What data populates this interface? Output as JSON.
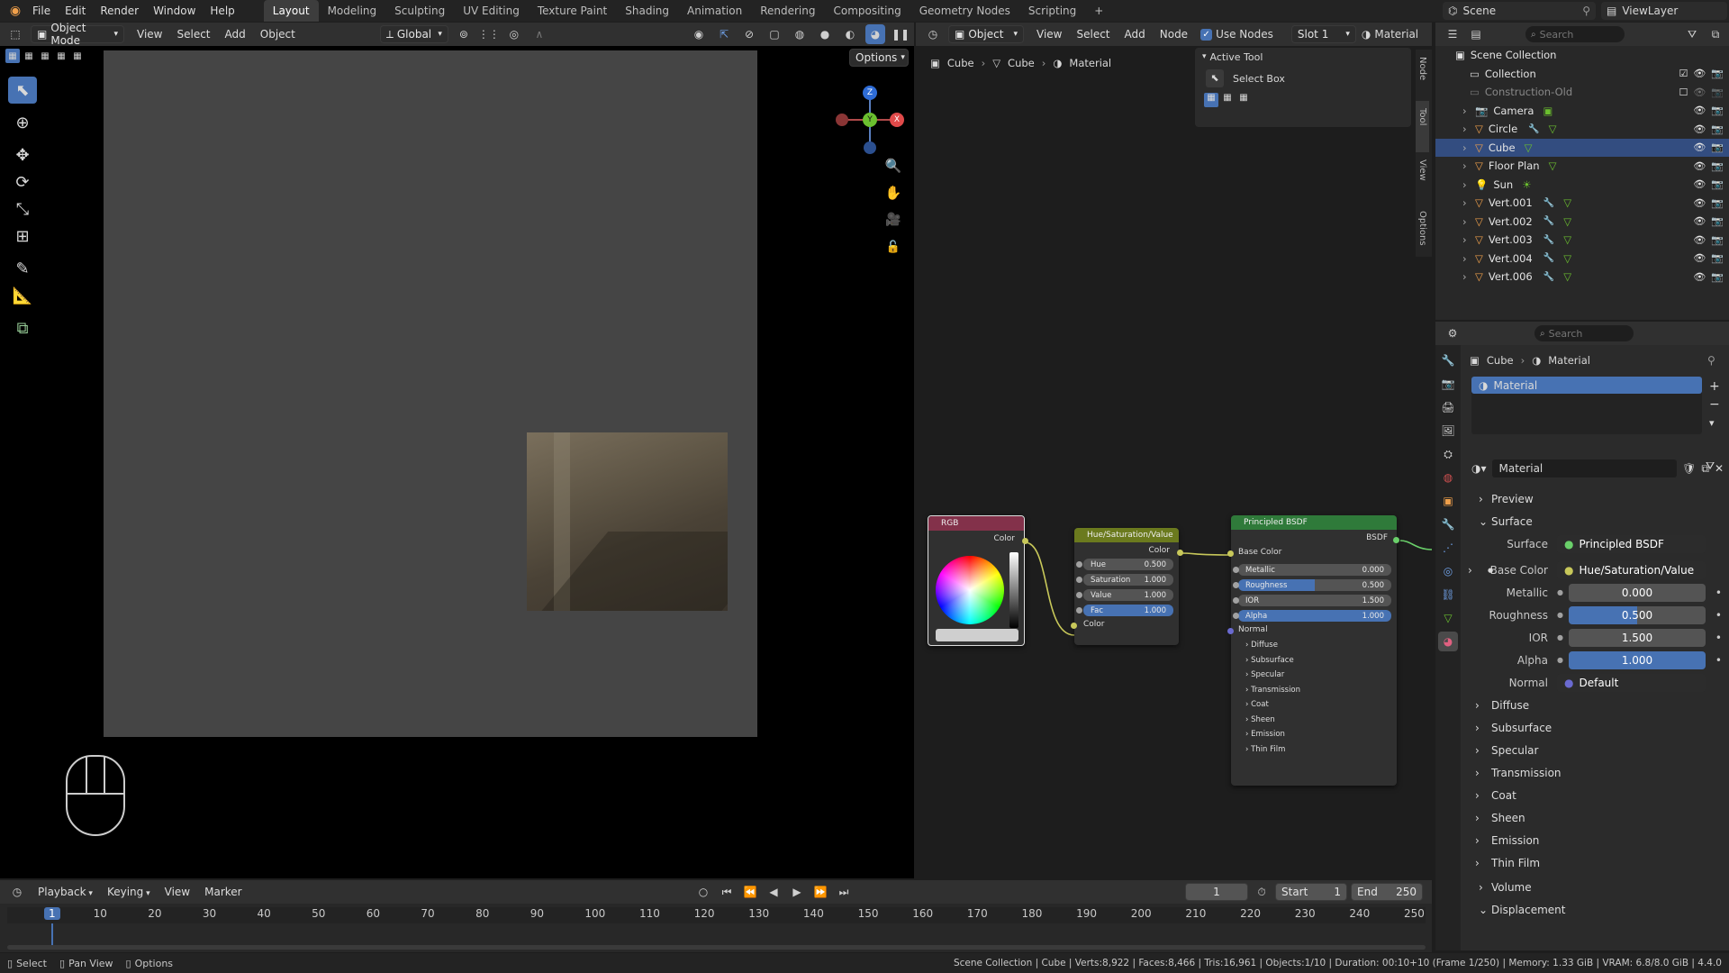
{
  "topbar": {
    "menu": [
      "File",
      "Edit",
      "Render",
      "Window",
      "Help"
    ],
    "workspaces": [
      "Layout",
      "Modeling",
      "Sculpting",
      "UV Editing",
      "Texture Paint",
      "Shading",
      "Animation",
      "Rendering",
      "Compositing",
      "Geometry Nodes",
      "Scripting"
    ],
    "active_workspace": "Layout",
    "add_tab": "+",
    "scene": "Scene",
    "view_layer": "ViewLayer"
  },
  "viewport": {
    "mode": "Object Mode",
    "menu": [
      "View",
      "Select",
      "Add",
      "Object"
    ],
    "transform_orientation": "Global",
    "options_label": "Options",
    "gizmo": {
      "z": "Z",
      "y": "Y",
      "x": "X"
    }
  },
  "node_editor": {
    "object_type": "Object",
    "menu": [
      "View",
      "Select",
      "Add",
      "Node"
    ],
    "use_nodes_label": "Use Nodes",
    "slot": "Slot 1",
    "material": "Material",
    "breadcrumb": [
      "Cube",
      "Cube",
      "Material"
    ],
    "side_tabs": [
      "Node",
      "Tool",
      "View",
      "Options"
    ],
    "active_tool": {
      "title": "Active Tool",
      "tool": "Select Box"
    },
    "rgb_node": {
      "title": "RGB",
      "output": "Color"
    },
    "hsv_node": {
      "title": "Hue/Saturation/Value",
      "output": "Color",
      "fields": [
        {
          "label": "Hue",
          "value": "0.500"
        },
        {
          "label": "Saturation",
          "value": "1.000"
        },
        {
          "label": "Value",
          "value": "1.000"
        },
        {
          "label": "Fac",
          "value": "1.000"
        }
      ],
      "input": "Color"
    },
    "bsdf_node": {
      "title": "Principled BSDF",
      "output": "BSDF",
      "base_color": "Base Color",
      "fields": [
        {
          "label": "Metallic",
          "value": "0.000",
          "fill": 0
        },
        {
          "label": "Roughness",
          "value": "0.500",
          "fill": 0.5
        },
        {
          "label": "IOR",
          "value": "1.500",
          "fill": 0
        },
        {
          "label": "Alpha",
          "value": "1.000",
          "fill": 1
        }
      ],
      "normal": "Normal",
      "subpanels": [
        "Diffuse",
        "Subsurface",
        "Specular",
        "Transmission",
        "Coat",
        "Sheen",
        "Emission",
        "Thin Film"
      ]
    }
  },
  "outliner": {
    "search_placeholder": "Search",
    "root": "Scene Collection",
    "items": [
      {
        "name": "Collection",
        "type": "collection"
      },
      {
        "name": "Construction-Old",
        "type": "collection-off"
      },
      {
        "name": "Camera",
        "type": "camera"
      },
      {
        "name": "Circle",
        "type": "mesh"
      },
      {
        "name": "Cube",
        "type": "mesh",
        "selected": true
      },
      {
        "name": "Floor Plan",
        "type": "mesh"
      },
      {
        "name": "Sun",
        "type": "light"
      },
      {
        "name": "Vert.001",
        "type": "mesh"
      },
      {
        "name": "Vert.002",
        "type": "mesh"
      },
      {
        "name": "Vert.003",
        "type": "mesh"
      },
      {
        "name": "Vert.004",
        "type": "mesh"
      },
      {
        "name": "Vert.006",
        "type": "mesh"
      }
    ]
  },
  "properties": {
    "search_placeholder": "Search",
    "breadcrumb": [
      "Cube",
      "Material"
    ],
    "slot_item": "Material",
    "material_name": "Material",
    "preview": "Preview",
    "surface_section": "Surface",
    "surface": {
      "label": "Surface",
      "value": "Principled BSDF"
    },
    "base_color": {
      "label": "Base Color",
      "value": "Hue/Saturation/Value"
    },
    "fields": [
      {
        "label": "Metallic",
        "value": "0.000",
        "fill": 0
      },
      {
        "label": "Roughness",
        "value": "0.500",
        "fill": 0.5
      },
      {
        "label": "IOR",
        "value": "1.500",
        "fill": 0
      },
      {
        "label": "Alpha",
        "value": "1.000",
        "fill": 1
      }
    ],
    "normal": {
      "label": "Normal",
      "value": "Default"
    },
    "subpanels": [
      "Diffuse",
      "Subsurface",
      "Specular",
      "Transmission",
      "Coat",
      "Sheen",
      "Emission",
      "Thin Film"
    ],
    "volume": "Volume",
    "displacement": "Displacement"
  },
  "timeline": {
    "menu": [
      "Playback",
      "Keying",
      "View",
      "Marker"
    ],
    "current_frame": "1",
    "start_label": "Start",
    "start": "1",
    "end_label": "End",
    "end": "250",
    "ticks": [
      "1",
      "10",
      "20",
      "30",
      "40",
      "50",
      "60",
      "70",
      "80",
      "90",
      "100",
      "110",
      "120",
      "130",
      "140",
      "150",
      "160",
      "170",
      "180",
      "190",
      "200",
      "210",
      "220",
      "230",
      "240",
      "250"
    ]
  },
  "statusbar": {
    "left": [
      "Select",
      "Pan View",
      "Options"
    ],
    "right": "Scene Collection | Cube | Verts:8,922 | Faces:8,466 | Tris:16,961 | Objects:1/10 | Duration: 00:10+10 (Frame 1/250) | Memory: 1.33 GiB | VRAM: 6.8/8.0 GiB | 4.4.0"
  },
  "colors": {
    "accent": "#4772b3",
    "selection": "#334d80",
    "rgb_node_header": "#83314a",
    "hsv_node_header": "#6b7a1e",
    "bsdf_node_header": "#2f7a3a"
  }
}
